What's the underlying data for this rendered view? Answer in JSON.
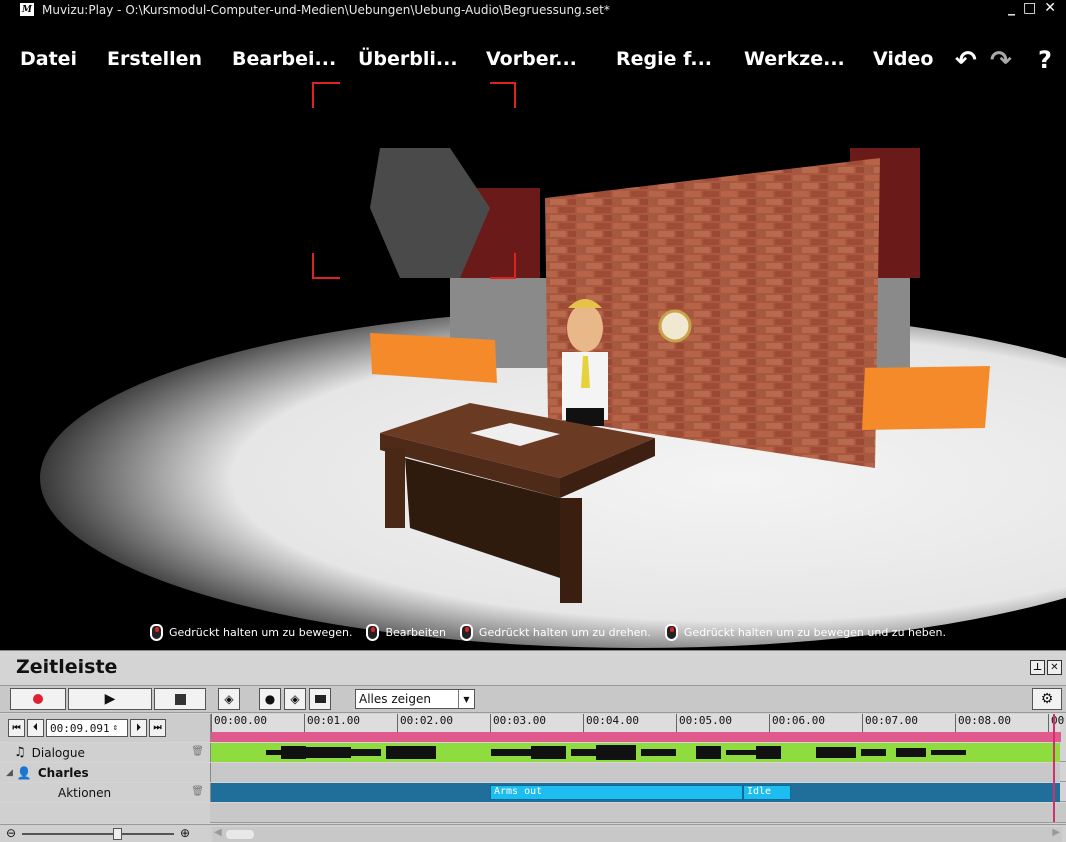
{
  "window": {
    "title": "Muvizu:Play - O:\\Kursmodul-Computer-und-Medien\\Uebungen\\Uebung-Audio\\Begruessung.set*",
    "logo_text": "M",
    "controls": [
      "_",
      "□",
      "✕"
    ]
  },
  "menu": {
    "items": [
      "Datei",
      "Erstellen",
      "Bearbei...",
      "Überbli...",
      "Vorber...",
      "Regie f...",
      "Werkze...",
      "Video"
    ],
    "undo_icon": "undo-icon",
    "redo_icon": "redo-icon",
    "help_label": "?"
  },
  "hints": {
    "move": "Gedrückt halten um zu bewegen.",
    "edit": "Bearbeiten",
    "rotate": "Gedrückt halten um zu drehen.",
    "move_lift": "Gedrückt halten um zu bewegen und zu heben."
  },
  "timeline": {
    "title": "Zeitleiste",
    "filter_value": "Alles zeigen",
    "time_value": "00:09.091",
    "ticks": [
      "00:00.00",
      "00:01.00",
      "00:02.00",
      "00:03.00",
      "00:04.00",
      "00:05.00",
      "00:06.00",
      "00:07.00",
      "00:08.00",
      "00"
    ],
    "tracks": {
      "dialogue_label": "Dialogue",
      "character_label": "Charles",
      "actions_label": "Aktionen"
    },
    "actions": [
      {
        "label": "Arms out",
        "start": 3.0,
        "end": 5.7
      },
      {
        "label": "Idle",
        "start": 5.7,
        "end": 6.25
      }
    ],
    "colors": {
      "dialogue": "#8fdc3e",
      "action": "#1ebdf0",
      "ruler": "#e05a8e",
      "actions_lane": "#1f6f9a"
    }
  }
}
